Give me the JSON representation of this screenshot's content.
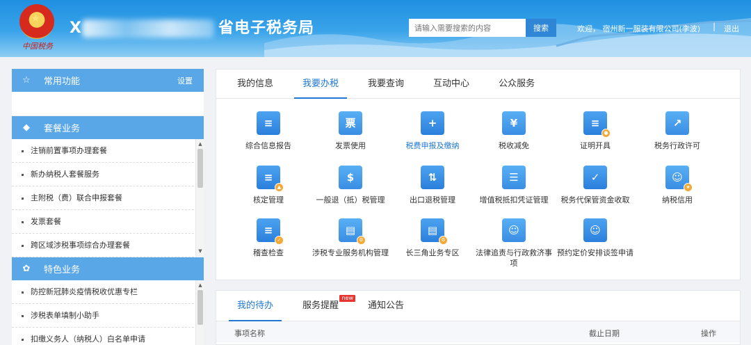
{
  "header": {
    "brand_script": "中国税务",
    "title_prefix": "X",
    "title_suffix": "省电子税务局",
    "search_placeholder": "请输入需要搜索的内容",
    "search_button": "搜索",
    "welcome": "欢迎， 宿州新一服装有限公司(李波)",
    "separator": "|",
    "logout": "退出"
  },
  "sidebar": {
    "common": {
      "title": "常用功能",
      "settings": "设置",
      "icon": "star-icon"
    },
    "packages": {
      "title": "套餐业务",
      "icon": "layers-icon",
      "items": [
        "注销前置事项办理套餐",
        "新办纳税人套餐服务",
        "主附税（费）联合申报套餐",
        "发票套餐",
        "跨区域涉税事项综合办理套餐"
      ]
    },
    "special": {
      "title": "特色业务",
      "icon": "flower-icon",
      "items": [
        "防控新冠肺炎疫情税收优惠专栏",
        "涉税表单填制小助手",
        "扣缴义务人（纳税人）白名单申请"
      ]
    }
  },
  "main": {
    "tabs": [
      "我的信息",
      "我要办税",
      "我要查询",
      "互动中心",
      "公众服务"
    ],
    "active_tab": "我要办税",
    "functions": [
      {
        "label": "综合信息报告",
        "icon": "report-icon"
      },
      {
        "label": "发票使用",
        "icon": "invoice-icon"
      },
      {
        "label": "税费申报及缴纳",
        "icon": "declare-icon"
      },
      {
        "label": "税收减免",
        "icon": "tax-relief-icon"
      },
      {
        "label": "证明开具",
        "icon": "certificate-icon"
      },
      {
        "label": "税务行政许可",
        "icon": "chart-icon"
      },
      {
        "label": "核定管理",
        "icon": "stamp-icon"
      },
      {
        "label": "一般退（抵）税管理",
        "icon": "refund-icon"
      },
      {
        "label": "出口退税管理",
        "icon": "export-refund-icon"
      },
      {
        "label": "增值税抵扣凭证管理",
        "icon": "cabinet-icon"
      },
      {
        "label": "税务代保管资金收取",
        "icon": "check-icon"
      },
      {
        "label": "纳税信用",
        "icon": "user-star-icon"
      },
      {
        "label": "稽查检查",
        "icon": "inspect-icon"
      },
      {
        "label": "涉税专业服务机构管理",
        "icon": "agency-gear-icon"
      },
      {
        "label": "长三角业务专区",
        "icon": "region-gear-icon"
      },
      {
        "label": "法律追责与行政救济事项",
        "icon": "legal-id-icon"
      },
      {
        "label": "预约定价安排谈签申请",
        "icon": "pricing-id-icon"
      }
    ]
  },
  "todo": {
    "tabs": [
      "我的待办",
      "服务提醒",
      "通知公告"
    ],
    "active_tab": "我的待办",
    "new_badge": "new",
    "columns": [
      "事项名称",
      "截止日期",
      "操作"
    ]
  },
  "colors": {
    "header_blue": "#2f8fe0",
    "accent_blue": "#1f78d1",
    "sidebar_head": "#5aa7e8",
    "badge_red": "#e8352f"
  }
}
